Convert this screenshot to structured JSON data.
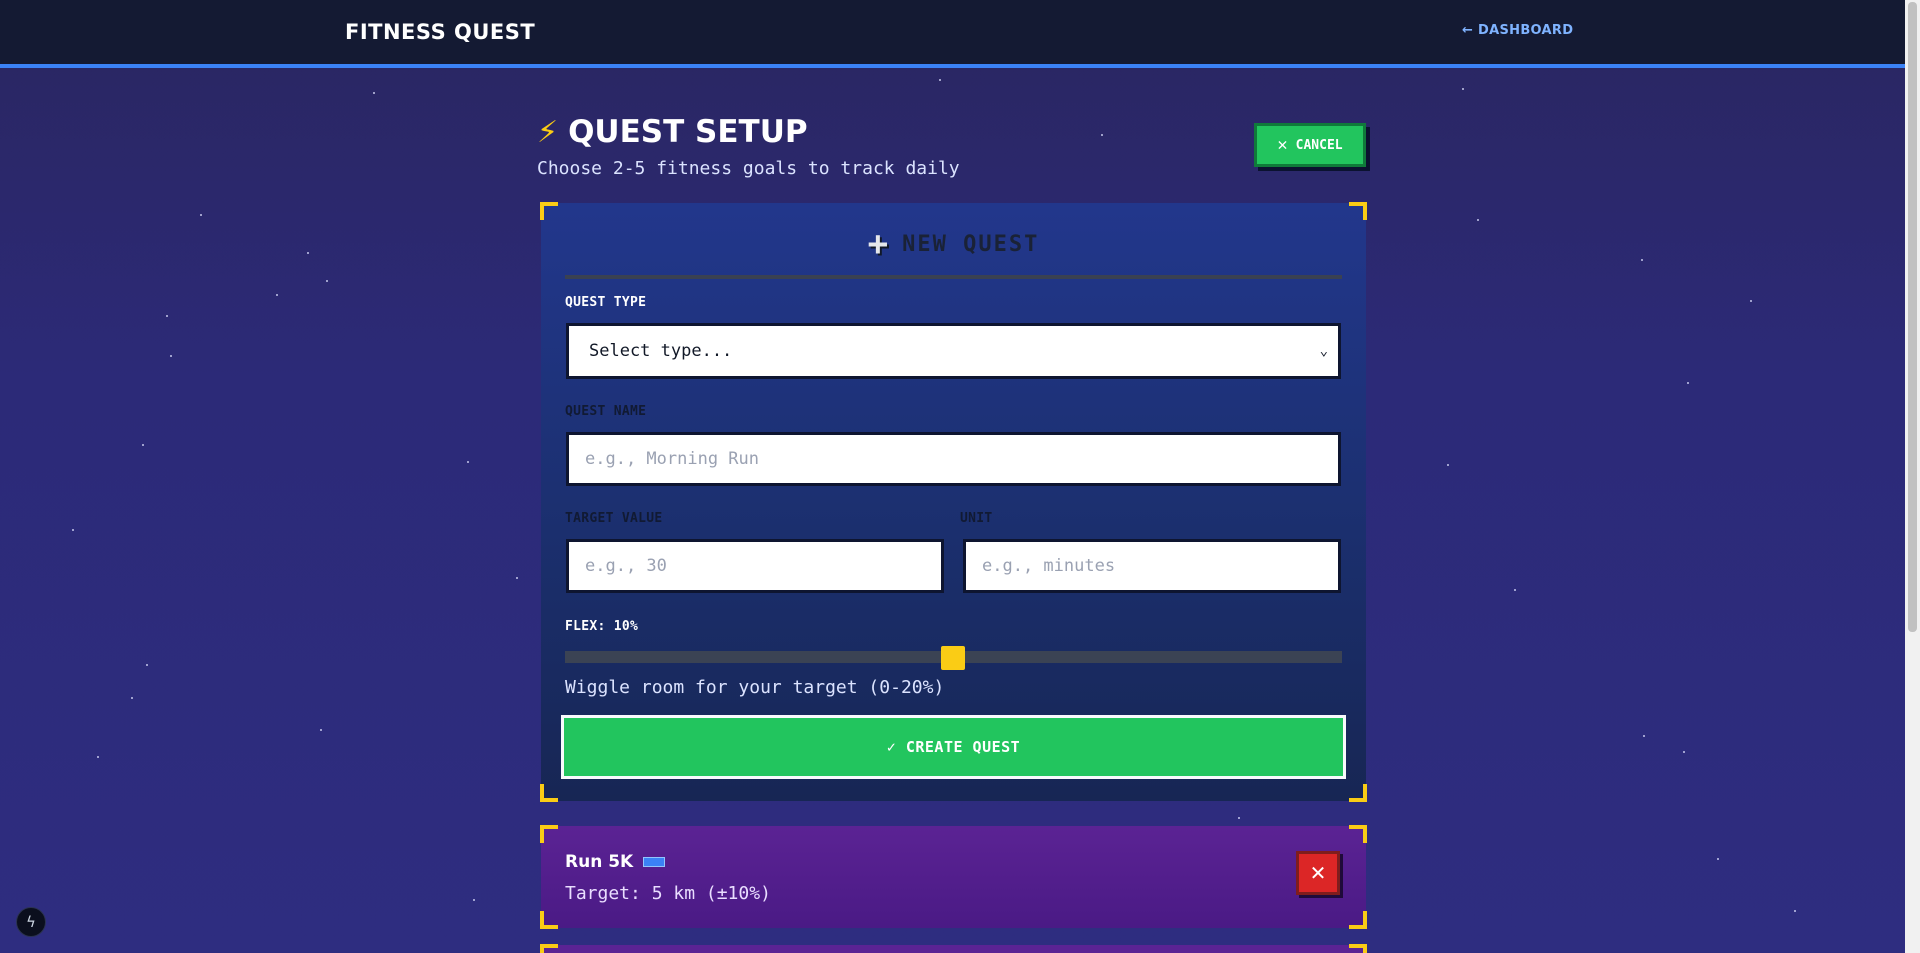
{
  "header": {
    "brand": "FITNESS QUEST",
    "dashboard_link": "← DASHBOARD"
  },
  "page": {
    "title_icon": "⚡",
    "title": "QUEST SETUP",
    "subtitle": "Choose 2-5 fitness goals to track daily",
    "cancel_icon": "✕",
    "cancel_label": "CANCEL"
  },
  "form": {
    "title_icon": "+",
    "title": "NEW QUEST",
    "quest_type": {
      "label": "QUEST TYPE",
      "selected": "Select type..."
    },
    "quest_name": {
      "label": "QUEST NAME",
      "placeholder": "e.g., Morning Run"
    },
    "target_value": {
      "label": "TARGET VALUE",
      "placeholder": "e.g., 30"
    },
    "unit": {
      "label": "UNIT",
      "placeholder": "e.g., minutes"
    },
    "flex": {
      "label": "FLEX: 10%",
      "value": 10,
      "min": 0,
      "max": 20,
      "hint": "Wiggle room for your target (0-20%)"
    },
    "create_label": "✓ CREATE QUEST"
  },
  "quests": [
    {
      "name": "Run 5K",
      "target": "Target: 5 km (±10%)",
      "delete_icon": "✕"
    }
  ],
  "colors": {
    "accent_green": "#22c55e",
    "accent_yellow": "#facc15",
    "accent_blue": "#3b82f6",
    "danger_red": "#dc2626"
  }
}
